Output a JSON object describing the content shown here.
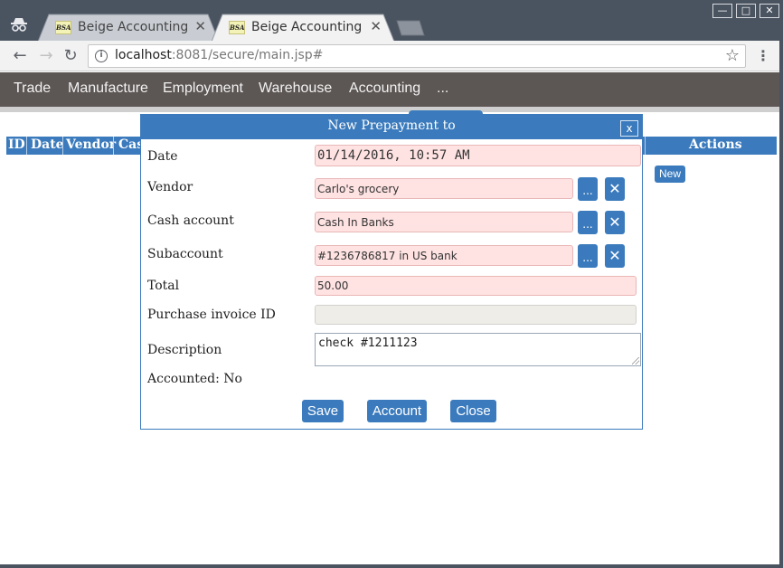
{
  "browser": {
    "tabs": [
      {
        "label": "Beige Accounting",
        "favicon_text": "BSA",
        "active": false
      },
      {
        "label": "Beige Accounting",
        "favicon_text": "BSA",
        "active": true
      }
    ],
    "url_host": "localhost",
    "url_rest": ":8081/secure/main.jsp#",
    "window_buttons": {
      "minimize": "—",
      "maximize": "□",
      "close": "✕"
    }
  },
  "menu": {
    "items": [
      "Trade",
      "Manufacture",
      "Employment",
      "Warehouse",
      "Accounting",
      "..."
    ]
  },
  "grid": {
    "columns": [
      "ID",
      "Date",
      "Vendor",
      "Cas",
      "Actions"
    ],
    "new_label": "New"
  },
  "dialog": {
    "title": "New Prepayment to",
    "close_label": "x",
    "fields": {
      "date": {
        "label": "Date",
        "value": "01/14/2016, 10:57 AM"
      },
      "vendor": {
        "label": "Vendor",
        "value": "Carlo's grocery"
      },
      "cash_account": {
        "label": "Cash account",
        "value": "Cash In Banks"
      },
      "subaccount": {
        "label": "Subaccount",
        "value": "#1236786817 in US bank"
      },
      "total": {
        "label": "Total",
        "value": "50.00"
      },
      "purchase_invoice_id": {
        "label": "Purchase invoice ID",
        "value": ""
      },
      "description": {
        "label": "Description",
        "value": "check #1211123"
      }
    },
    "accounted": "Accounted: No",
    "picker_label": "...",
    "clear_label": "✕",
    "buttons": {
      "save": "Save",
      "account": "Account",
      "close": "Close"
    }
  },
  "colors": {
    "accent": "#3b7bbd",
    "menu_bar": "#5c5654",
    "required_field": "#ffe2e2",
    "browser_frame": "#4a5360"
  }
}
